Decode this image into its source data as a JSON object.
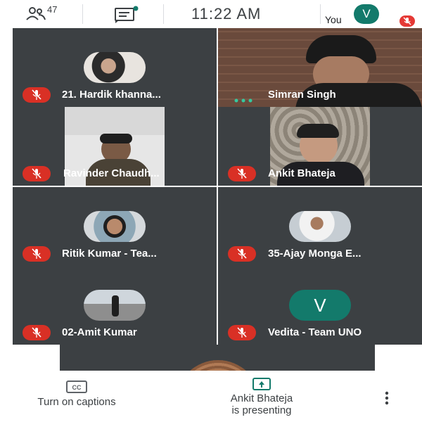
{
  "top_bar": {
    "participant_count": "47",
    "time": "11:22  AM",
    "you_label": "You",
    "you_initial": "V"
  },
  "tiles": [
    {
      "name": "21. Hardik khanna..."
    },
    {
      "name": "Simran Singh"
    },
    {
      "name": "Ravinder Chaudh..."
    },
    {
      "name": "Ankit Bhateja"
    },
    {
      "name": "Ritik Kumar - Tea..."
    },
    {
      "name": "35-Ajay Monga E..."
    },
    {
      "name": "02-Amit Kumar"
    },
    {
      "name": "Vedita - Team UNO",
      "initial": "V"
    }
  ],
  "bottom_bar": {
    "captions_label": "Turn on captions",
    "presenting_line1": "Ankit Bhateja",
    "presenting_line2": "is presenting"
  },
  "colors": {
    "tile_bg": "#3c4043",
    "mute_red": "#d93025",
    "avatar_teal": "#137a6b",
    "presenting_green": "#137a6b"
  }
}
